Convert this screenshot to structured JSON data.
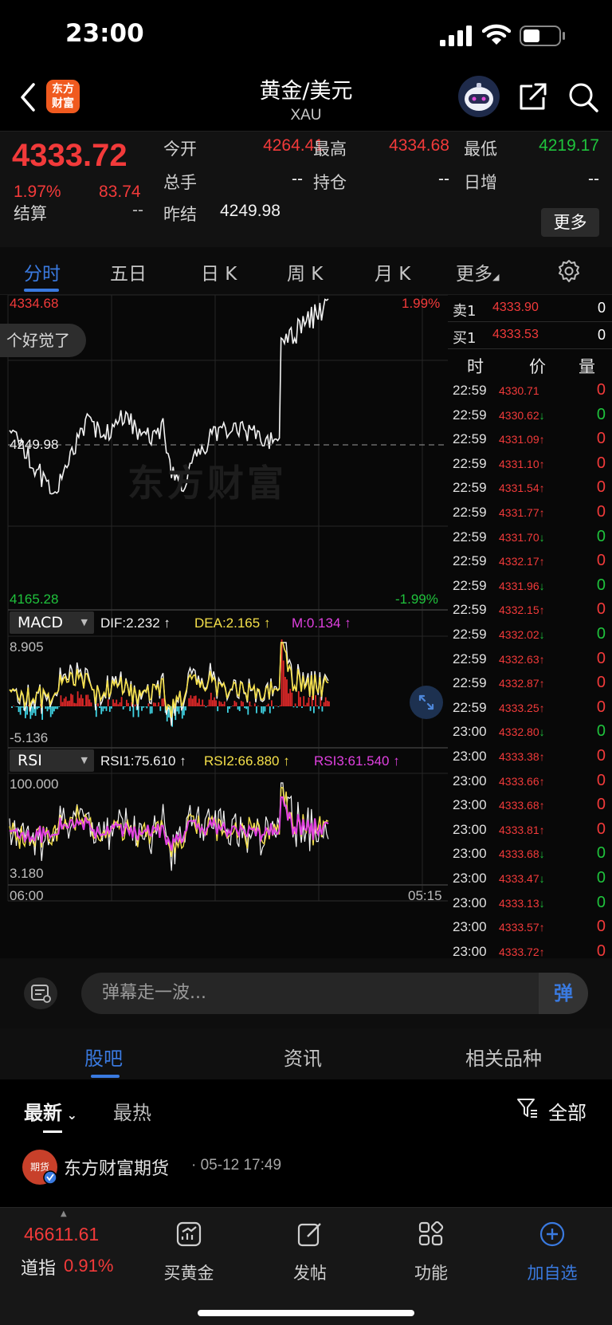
{
  "status_bar": {
    "time": "23:00"
  },
  "header": {
    "logo_text_1": "东方",
    "logo_text_2": "财富",
    "title": "黄金/美元",
    "subtitle": "XAU"
  },
  "quote": {
    "last": "4333.72",
    "change_pct": "1.97%",
    "change_val": "83.74",
    "settle_label": "结算",
    "settle_val": "--",
    "prev_settle_label": "昨结",
    "prev_settle_val": "4249.98",
    "open_label": "今开",
    "open_val": "4264.41",
    "high_label": "最高",
    "high_val": "4334.68",
    "low_label": "最低",
    "low_val": "4219.17",
    "volume_label": "总手",
    "volume_val": "--",
    "oi_label": "持仓",
    "oi_val": "--",
    "daily_inc_label": "日增",
    "daily_inc_val": "--",
    "more_button": "更多"
  },
  "tabs": [
    {
      "label": "分时",
      "active": true
    },
    {
      "label": "五日",
      "active": false
    },
    {
      "label": "日 K",
      "active": false
    },
    {
      "label": "周 K",
      "active": false
    },
    {
      "label": "月 K",
      "active": false
    },
    {
      "label": "更多",
      "active": false
    }
  ],
  "chart": {
    "price_top": "4334.68",
    "price_mid": "4249.98",
    "price_bottom": "4165.28",
    "pct_top": "1.99%",
    "pct_bottom": "-1.99%",
    "watermark": "东方财富",
    "tip": "个好觉了",
    "time_start": "06:00",
    "time_end": "05:15",
    "macd": {
      "name": "MACD",
      "dif": "DIF:2.232 ↑",
      "dea": "DEA:2.165 ↑",
      "m": "M:0.134 ↑",
      "max": "8.905",
      "min": "-5.136"
    },
    "rsi": {
      "name": "RSI",
      "rsi1": "RSI1:75.610 ↑",
      "rsi2": "RSI2:66.880 ↑",
      "rsi3": "RSI3:61.540 ↑",
      "max": "100.000",
      "min": "3.180"
    }
  },
  "book": {
    "ask_label": "卖1",
    "ask_price": "4333.90",
    "ask_vol": "0",
    "bid_label": "买1",
    "bid_price": "4333.53",
    "bid_vol": "0",
    "col_time": "时",
    "col_price": "价",
    "col_vol": "量"
  },
  "ticks": [
    {
      "time": "22:59",
      "price": "4330.71",
      "arrow": "",
      "vol": "0",
      "dir": "up"
    },
    {
      "time": "22:59",
      "price": "4330.62",
      "arrow": "↓",
      "vol": "0",
      "dir": "down"
    },
    {
      "time": "22:59",
      "price": "4331.09",
      "arrow": "↑",
      "vol": "0",
      "dir": "up"
    },
    {
      "time": "22:59",
      "price": "4331.10",
      "arrow": "↑",
      "vol": "0",
      "dir": "up"
    },
    {
      "time": "22:59",
      "price": "4331.54",
      "arrow": "↑",
      "vol": "0",
      "dir": "up"
    },
    {
      "time": "22:59",
      "price": "4331.77",
      "arrow": "↑",
      "vol": "0",
      "dir": "up"
    },
    {
      "time": "22:59",
      "price": "4331.70",
      "arrow": "↓",
      "vol": "0",
      "dir": "down"
    },
    {
      "time": "22:59",
      "price": "4332.17",
      "arrow": "↑",
      "vol": "0",
      "dir": "up"
    },
    {
      "time": "22:59",
      "price": "4331.96",
      "arrow": "↓",
      "vol": "0",
      "dir": "down"
    },
    {
      "time": "22:59",
      "price": "4332.15",
      "arrow": "↑",
      "vol": "0",
      "dir": "up"
    },
    {
      "time": "22:59",
      "price": "4332.02",
      "arrow": "↓",
      "vol": "0",
      "dir": "down"
    },
    {
      "time": "22:59",
      "price": "4332.63",
      "arrow": "↑",
      "vol": "0",
      "dir": "up"
    },
    {
      "time": "22:59",
      "price": "4332.87",
      "arrow": "↑",
      "vol": "0",
      "dir": "up"
    },
    {
      "time": "22:59",
      "price": "4333.25",
      "arrow": "↑",
      "vol": "0",
      "dir": "up"
    },
    {
      "time": "23:00",
      "price": "4332.80",
      "arrow": "↓",
      "vol": "0",
      "dir": "down"
    },
    {
      "time": "23:00",
      "price": "4333.38",
      "arrow": "↑",
      "vol": "0",
      "dir": "up"
    },
    {
      "time": "23:00",
      "price": "4333.66",
      "arrow": "↑",
      "vol": "0",
      "dir": "up"
    },
    {
      "time": "23:00",
      "price": "4333.68",
      "arrow": "↑",
      "vol": "0",
      "dir": "up"
    },
    {
      "time": "23:00",
      "price": "4333.81",
      "arrow": "↑",
      "vol": "0",
      "dir": "up"
    },
    {
      "time": "23:00",
      "price": "4333.68",
      "arrow": "↓",
      "vol": "0",
      "dir": "down"
    },
    {
      "time": "23:00",
      "price": "4333.47",
      "arrow": "↓",
      "vol": "0",
      "dir": "down"
    },
    {
      "time": "23:00",
      "price": "4333.13",
      "arrow": "↓",
      "vol": "0",
      "dir": "down"
    },
    {
      "time": "23:00",
      "price": "4333.57",
      "arrow": "↑",
      "vol": "0",
      "dir": "up"
    },
    {
      "time": "23:00",
      "price": "4333.72",
      "arrow": "↑",
      "vol": "0",
      "dir": "up"
    }
  ],
  "barrage": {
    "placeholder": "弹幕走一波...",
    "button": "弹"
  },
  "community_tabs": [
    "股吧",
    "资讯",
    "相关品种"
  ],
  "sort": {
    "latest": "最新",
    "hot": "最热",
    "filter": "全部"
  },
  "post": {
    "avatar_text": "期货",
    "author": "东方财富期货",
    "time": "· 05-12 17:49"
  },
  "bottom_nav": {
    "index_value": "46611.61",
    "index_name": "道指",
    "index_pct": "0.91%",
    "items": [
      "买黄金",
      "发帖",
      "功能",
      "加自选"
    ]
  },
  "colors": {
    "up": "#f23a3a",
    "down": "#1fc33c",
    "accent": "#3a7ae0",
    "dea": "#f5e04a",
    "m": "#e040e0"
  }
}
